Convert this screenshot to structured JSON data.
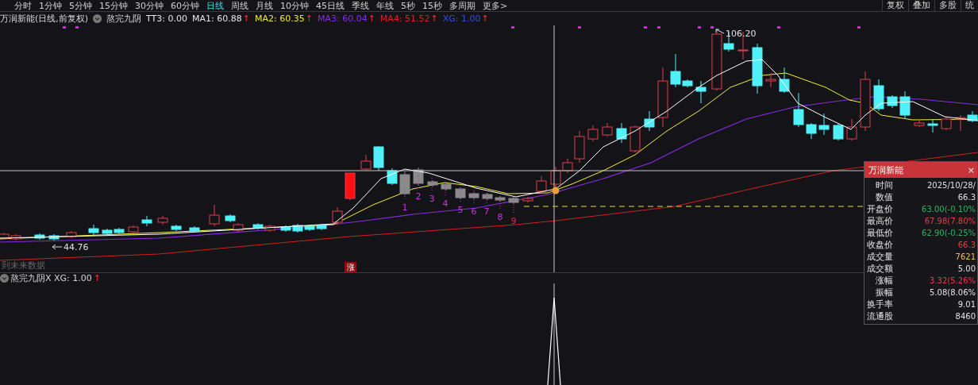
{
  "toolbar": {
    "periods": [
      {
        "label": "分时",
        "selected": false
      },
      {
        "label": "1分钟",
        "selected": false
      },
      {
        "label": "5分钟",
        "selected": false
      },
      {
        "label": "15分钟",
        "selected": false
      },
      {
        "label": "30分钟",
        "selected": false
      },
      {
        "label": "60分钟",
        "selected": false
      },
      {
        "label": "日线",
        "selected": true
      },
      {
        "label": "周线",
        "selected": false
      },
      {
        "label": "月线",
        "selected": false
      },
      {
        "label": "10分钟",
        "selected": false
      },
      {
        "label": "45日线",
        "selected": false
      },
      {
        "label": "季线",
        "selected": false
      },
      {
        "label": "年线",
        "selected": false
      },
      {
        "label": "5秒",
        "selected": false
      },
      {
        "label": "15秒",
        "selected": false
      },
      {
        "label": "多周期",
        "selected": false
      },
      {
        "label": "更多>",
        "selected": false
      }
    ],
    "buttons": [
      "复权",
      "叠加",
      "多股",
      "统"
    ]
  },
  "legend": {
    "title": "万润新能(日线,前复权)",
    "indicator": "熬完九阴",
    "items": [
      {
        "text": "TT3: 0.00",
        "color": "#e6e6e6"
      },
      {
        "text": "MA1: 60.88",
        "color": "#e6e6e6",
        "arrow": "↑"
      },
      {
        "text": "MA2: 60.35",
        "color": "#f0e830",
        "arrow": "↑"
      },
      {
        "text": "MA3: 60.04",
        "color": "#8a2be2",
        "arrow": "↑"
      },
      {
        "text": "MA4: 51.52",
        "color": "#e02020",
        "arrow": "↑"
      },
      {
        "text": "XG: 1.00",
        "color": "#3050e0",
        "arrow": "↑"
      }
    ]
  },
  "chart": {
    "high_label": "106.20",
    "low_label": "44.76",
    "note": "到未来数据",
    "badge": "涨",
    "sequence": [
      "1",
      "2",
      "3",
      "4",
      "5",
      "6",
      "7",
      "8",
      "9"
    ]
  },
  "info_panel": {
    "title": "万润新能",
    "close": "×",
    "rows": [
      {
        "label": "时间",
        "value": "2025/10/28/",
        "color": "#e0e0e0"
      },
      {
        "label": "数值",
        "value": "66.3",
        "color": "#e0e0e0"
      },
      {
        "label": "开盘价",
        "value": "63.00(-0.10%",
        "color": "#30b060"
      },
      {
        "label": "最高价",
        "value": "67.98(7.80%",
        "color": "#e0404a"
      },
      {
        "label": "最低价",
        "value": "62.90(-0.25%",
        "color": "#30b060"
      },
      {
        "label": "收盘价",
        "value": "66.3",
        "color": "#e0404a"
      },
      {
        "label": "成交量",
        "value": "7621",
        "color": "#f0c050"
      },
      {
        "label": "成交额",
        "value": "5.00",
        "color": "#e0e0e0"
      },
      {
        "label": "涨幅",
        "value": "3.32(5.26%",
        "color": "#e0404a"
      },
      {
        "label": "振幅",
        "value": "5.08(8.06%",
        "color": "#e0e0e0"
      },
      {
        "label": "换手率",
        "value": "9.01",
        "color": "#e0e0e0"
      },
      {
        "label": "流通股",
        "value": "8460",
        "color": "#e0e0e0"
      }
    ]
  },
  "sub_chart": {
    "legend": "熬完九阴X XG: 1.00",
    "arrow": "↑"
  }
}
